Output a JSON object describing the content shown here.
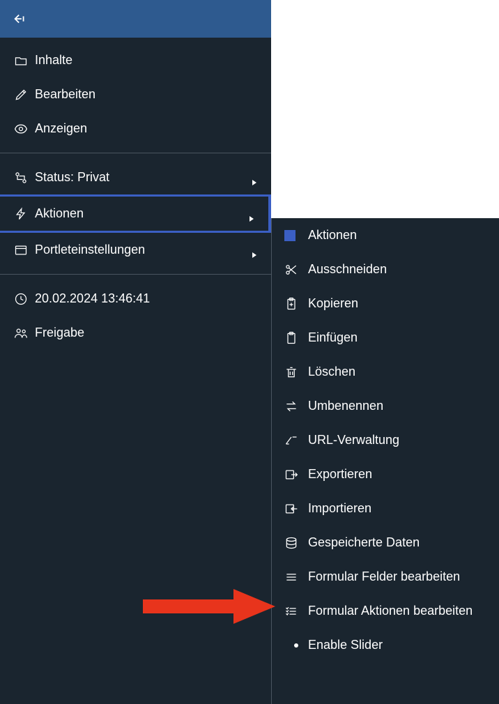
{
  "sidebar": {
    "items": [
      {
        "label": "Inhalte"
      },
      {
        "label": "Bearbeiten"
      },
      {
        "label": "Anzeigen"
      },
      {
        "label": "Status: Privat"
      },
      {
        "label": "Aktionen"
      },
      {
        "label": "Portleteinstellungen"
      },
      {
        "label": "20.02.2024 13:46:41"
      },
      {
        "label": "Freigabe"
      }
    ]
  },
  "submenu": {
    "header": "Aktionen",
    "items": [
      {
        "label": "Ausschneiden"
      },
      {
        "label": "Kopieren"
      },
      {
        "label": "Einfügen"
      },
      {
        "label": "Löschen"
      },
      {
        "label": "Umbenennen"
      },
      {
        "label": "URL-Verwaltung"
      },
      {
        "label": "Exportieren"
      },
      {
        "label": "Importieren"
      },
      {
        "label": "Gespeicherte Daten"
      },
      {
        "label": "Formular Felder bearbeiten"
      },
      {
        "label": "Formular Aktionen bearbeiten"
      },
      {
        "label": "Enable Slider"
      }
    ]
  }
}
